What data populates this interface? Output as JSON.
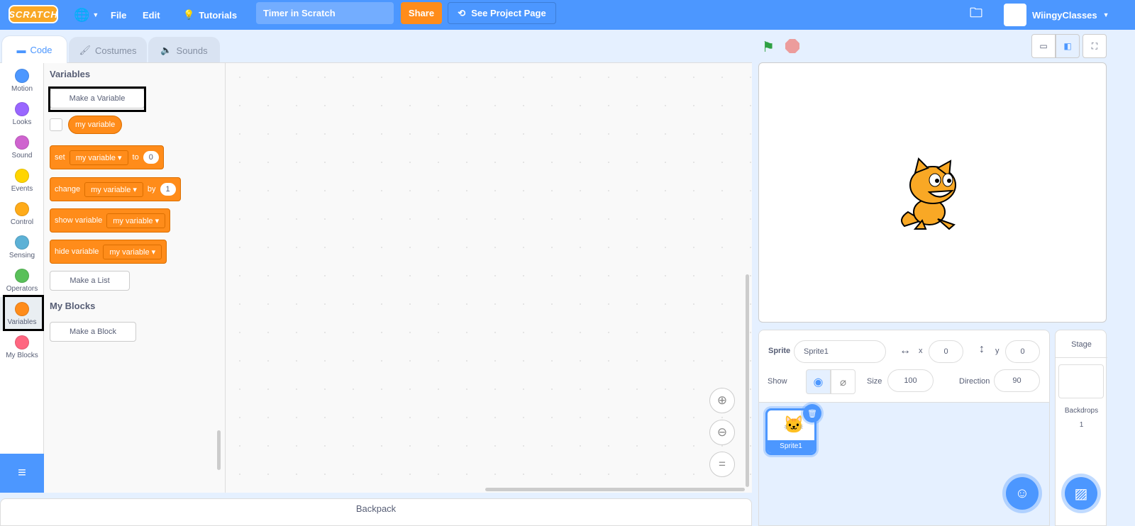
{
  "menubar": {
    "logo": "SCRATCH",
    "file": "File",
    "edit": "Edit",
    "tutorials": "Tutorials",
    "project_title": "Timer in Scratch",
    "share": "Share",
    "see_project_page": "See Project Page",
    "username": "WiingyClasses"
  },
  "tabs": {
    "code": "Code",
    "costumes": "Costumes",
    "sounds": "Sounds"
  },
  "categories": [
    {
      "label": "Motion",
      "color": "#4c97ff"
    },
    {
      "label": "Looks",
      "color": "#9966ff"
    },
    {
      "label": "Sound",
      "color": "#cf63cf"
    },
    {
      "label": "Events",
      "color": "#ffd500"
    },
    {
      "label": "Control",
      "color": "#ffab19"
    },
    {
      "label": "Sensing",
      "color": "#5cb1d6"
    },
    {
      "label": "Operators",
      "color": "#59c059"
    },
    {
      "label": "Variables",
      "color": "#ff8c1a"
    },
    {
      "label": "My Blocks",
      "color": "#ff6680"
    }
  ],
  "palette": {
    "variables_heading": "Variables",
    "make_variable": "Make a Variable",
    "reporter": "my variable",
    "set": {
      "word": "set",
      "var": "my variable",
      "to": "to",
      "value": "0"
    },
    "change": {
      "word": "change",
      "var": "my variable",
      "by": "by",
      "value": "1"
    },
    "show": {
      "word": "show variable",
      "var": "my variable"
    },
    "hide": {
      "word": "hide variable",
      "var": "my variable"
    },
    "make_list": "Make a List",
    "myblocks_heading": "My Blocks",
    "make_block": "Make a Block"
  },
  "backpack": "Backpack",
  "sprite_info": {
    "sprite_label": "Sprite",
    "sprite_name": "Sprite1",
    "x_label": "x",
    "x": "0",
    "y_label": "y",
    "y": "0",
    "show_label": "Show",
    "size_label": "Size",
    "size": "100",
    "direction_label": "Direction",
    "direction": "90"
  },
  "sprites": [
    {
      "name": "Sprite1"
    }
  ],
  "stage_pane": {
    "title": "Stage",
    "backdrops_label": "Backdrops",
    "backdrops_count": "1"
  },
  "colors": {
    "accent": "#4c97ff",
    "variables": "#ff8c1a",
    "share": "#ff8c1a"
  }
}
